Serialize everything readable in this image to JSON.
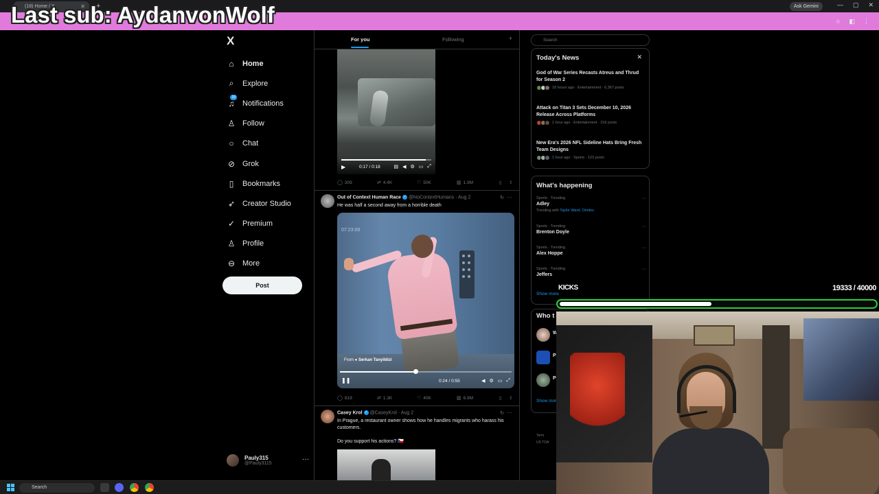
{
  "browser": {
    "tab_title": "(18) Home / X",
    "ask_gemini": "Ask Gemini"
  },
  "overlay": {
    "banner_text": "Last sub: AydanvonWolf",
    "kicks_label": "KICKS",
    "kicks_count": "19333 / 40000",
    "kicks_progress": 0.483
  },
  "nav": {
    "logo": "X",
    "items": [
      {
        "label": "Home",
        "icon": "home-icon"
      },
      {
        "label": "Explore",
        "icon": "search-icon"
      },
      {
        "label": "Notifications",
        "icon": "bell-icon"
      },
      {
        "label": "Follow",
        "icon": "person-add-icon"
      },
      {
        "label": "Chat",
        "icon": "chat-icon"
      },
      {
        "label": "Grok",
        "icon": "grok-icon"
      },
      {
        "label": "Bookmarks",
        "icon": "bookmark-icon"
      },
      {
        "label": "Creator Studio",
        "icon": "rocket-icon"
      },
      {
        "label": "Premium",
        "icon": "premium-icon"
      },
      {
        "label": "Profile",
        "icon": "profile-icon"
      },
      {
        "label": "More",
        "icon": "more-circle-icon"
      }
    ],
    "notif_badge": "18",
    "post_label": "Post"
  },
  "account": {
    "name": "Pauly315",
    "handle": "@Pauly3115"
  },
  "feed": {
    "tabs": [
      "For you",
      "Following"
    ],
    "tweet1": {
      "video_time": "0:17 / 0:18",
      "progress": 0.94,
      "replies": "309",
      "reposts": "4.4K",
      "likes": "50K",
      "views": "1.9M"
    },
    "tweet2": {
      "name": "Out of Context Human Race",
      "handle": "@NoContextHumans",
      "date": "· Aug 2",
      "text": "He was half a second away from a horrible death",
      "video_timestamp": "07:23:08",
      "from_prefix": "From",
      "from_name": "Serkan Tanyildizi",
      "video_time": "0:24 / 0:55",
      "progress": 0.44,
      "replies": "819",
      "reposts": "1.3K",
      "likes": "40K",
      "views": "6.9M"
    },
    "tweet3": {
      "name": "Casey Krol",
      "handle": "@CaseyKrol",
      "date": "· Aug 2",
      "text": "In Prague, a restaurant owner shows how he handles migrants who harass his customers.",
      "text2": "Do you support his actions? 🇨🇿"
    }
  },
  "sidebar": {
    "search_placeholder": "Search",
    "news_title": "Today's News",
    "news": [
      {
        "title": "God of War Series Recasts Atreus and Thrud for Season 2",
        "meta": "18 hours ago · Entertainment · 6,367 posts"
      },
      {
        "title": "Attack on Titan 3 Sets December 10, 2026 Release Across Platforms",
        "meta": "1 hour ago · Entertainment · 216 posts"
      },
      {
        "title": "New Era's 2026 NFL Sideline Hats Bring Fresh Team Designs",
        "meta": "1 hour ago · Sports · 123 posts"
      }
    ],
    "happening_title": "What's happening",
    "trends": [
      {
        "category": "Sports · Trending",
        "name": "Adley",
        "with_prefix": "Trending with",
        "with": "Taylor Ward, Orioles"
      },
      {
        "category": "Sports · Trending",
        "name": "Brenton Doyle"
      },
      {
        "category": "Sports · Trending",
        "name": "Alex Hoppe"
      },
      {
        "category": "Sports · Trending",
        "name": "Jeffers"
      }
    ],
    "show_more": "Show more",
    "who_title": "Who t",
    "who": [
      "W",
      "P",
      "P"
    ],
    "footer": [
      "Term",
      "US TOA"
    ]
  },
  "taskbar": {
    "search_label": "Search"
  },
  "colors": {
    "accent": "#1d9bf0",
    "banner": "#e07bdc",
    "kicks_border": "#27d339"
  }
}
